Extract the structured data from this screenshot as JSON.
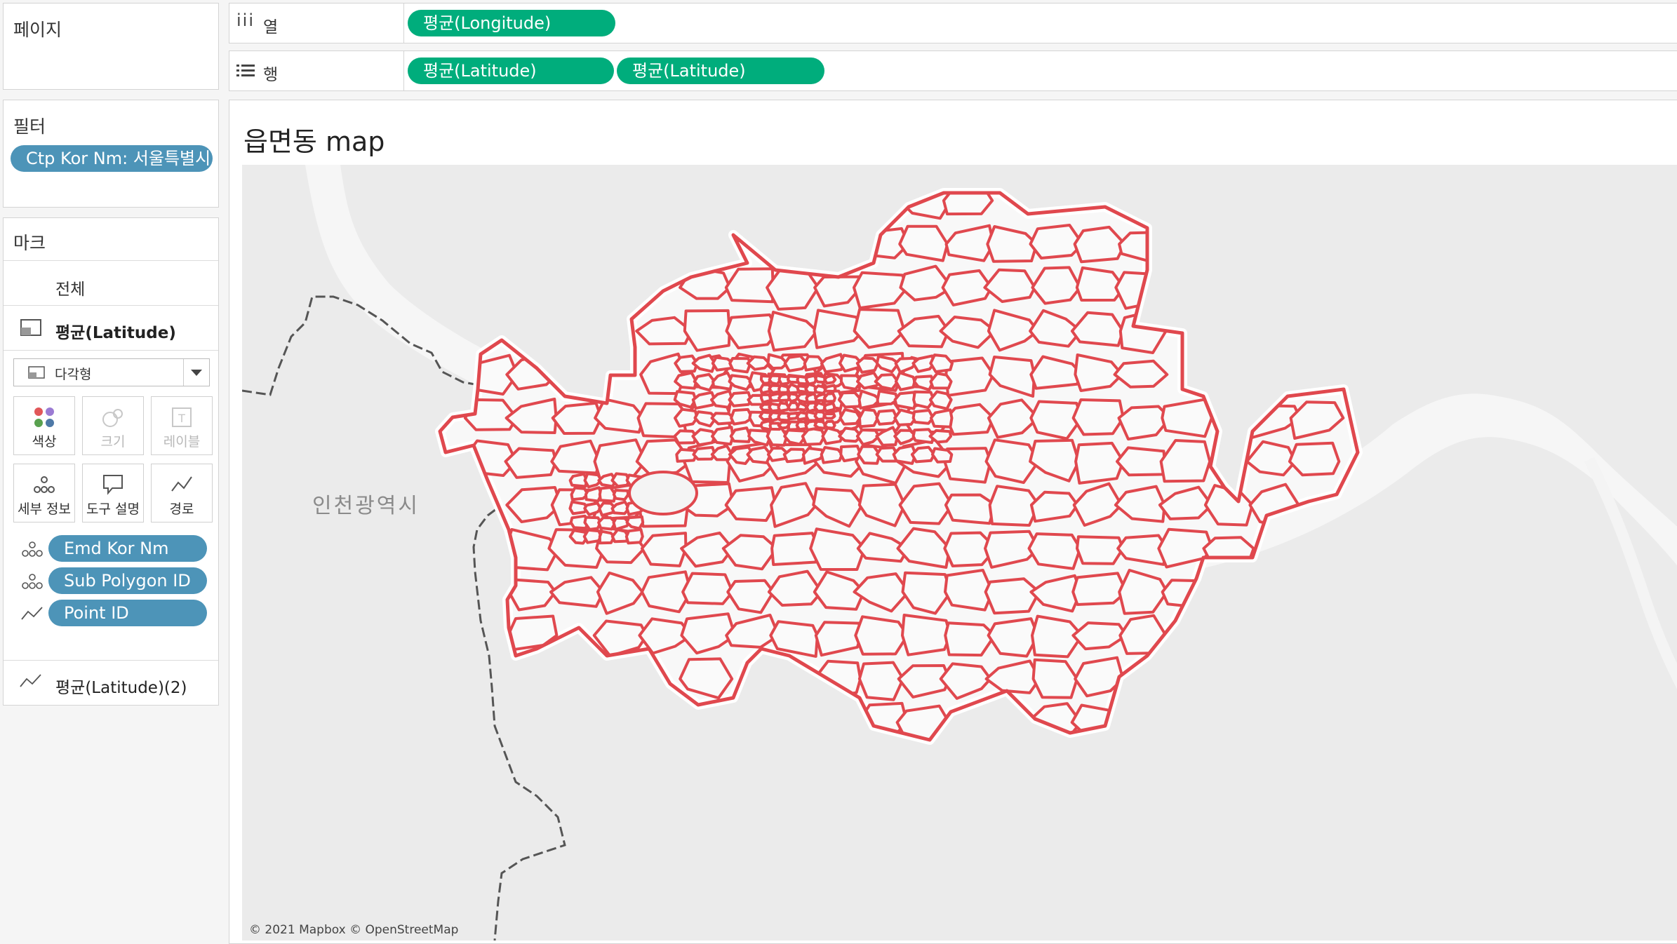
{
  "left_panel": {
    "pages_title": "페이지",
    "filters_title": "필터",
    "filter_pill": "Ctp Kor Nm: 서울특별시",
    "marks_title": "마크",
    "marks_all": "전체",
    "marks_layer1": "평균(Latitude)",
    "mark_type": "다각형",
    "buttons": {
      "color": "색상",
      "size": "크기",
      "label": "레이블",
      "detail": "세부 정보",
      "tooltip": "도구 설명",
      "path": "경로"
    },
    "mark_pills": [
      "Emd Kor Nm",
      "Sub Polygon ID",
      "Point ID"
    ],
    "marks_layer2": "평균(Latitude)(2)"
  },
  "shelves": {
    "columns_label": "열",
    "rows_label": "행",
    "columns_pill": "평균(Longitude)",
    "rows_pills": [
      "평균(Latitude)",
      "평균(Latitude)"
    ]
  },
  "view": {
    "title": "읍면동 map",
    "map_place_label": "인천광역시",
    "attribution": "© 2021 Mapbox © OpenStreetMap",
    "polygon_color": "#e0484e",
    "land_color": "#ebebeb",
    "water_color": "#f6f6f6"
  },
  "colors": {
    "dimension_pill": "#4d94b8",
    "measure_pill": "#00ad7c"
  }
}
